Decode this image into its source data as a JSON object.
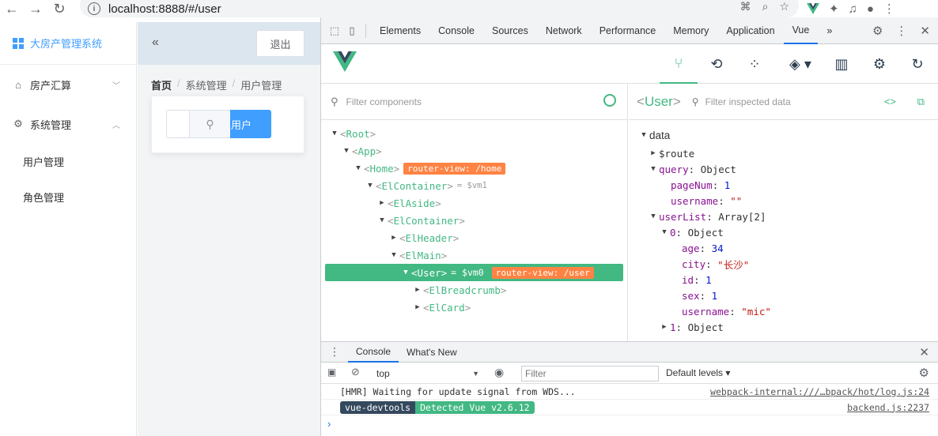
{
  "browser": {
    "url": "localhost:8888/#/user"
  },
  "app": {
    "brand": "大房产管理系统",
    "menu": [
      {
        "label": "房产汇算"
      },
      {
        "label": "系统管理"
      }
    ],
    "submenu": [
      {
        "label": "用户管理"
      },
      {
        "label": "角色管理"
      }
    ],
    "logout_label": "退出",
    "collapse_glyph": "«",
    "breadcrumb": [
      "首页",
      "系统管理",
      "用户管理"
    ],
    "breadcrumb_sep": "/",
    "add_button_label": "加用户"
  },
  "devtools": {
    "tabs": [
      "Elements",
      "Console",
      "Sources",
      "Network",
      "Performance",
      "Memory",
      "Application",
      "Vue"
    ],
    "more": "»",
    "active_tab": "Vue",
    "filter_components_placeholder": "Filter components",
    "filter_inspected_placeholder": "Filter inspected data",
    "selected_component": "User",
    "tree": [
      {
        "name": "Root",
        "open": true
      },
      {
        "name": "App",
        "open": true
      },
      {
        "name": "Home",
        "open": true,
        "badge": "router-view: /home"
      },
      {
        "name": "ElContainer",
        "open": true,
        "vm": "= $vm1"
      },
      {
        "name": "ElAside",
        "open": false
      },
      {
        "name": "ElContainer",
        "open": true
      },
      {
        "name": "ElHeader",
        "open": false
      },
      {
        "name": "ElMain",
        "open": true
      },
      {
        "name": "User",
        "open": true,
        "vm": "= $vm0",
        "badge": "router-view: /user",
        "selected": true
      },
      {
        "name": "ElBreadcrumb",
        "open": false
      },
      {
        "name": "ElCard",
        "open": false
      }
    ],
    "state": {
      "section": "data",
      "route_key": "$route",
      "query_key": "query",
      "query_type": "Object",
      "pageNum_key": "pageNum",
      "pageNum_val": "1",
      "username_key": "username",
      "username_val": "\"\"",
      "userList_key": "userList",
      "userList_type": "Array[2]",
      "item0_key": "0",
      "item0_type": "Object",
      "age_key": "age",
      "age_val": "34",
      "city_key": "city",
      "city_val": "\"长沙\"",
      "id_key": "id",
      "id_val": "1",
      "sex_key": "sex",
      "sex_val": "1",
      "uname_key": "username",
      "uname_val": "\"mic\"",
      "item1_key": "1",
      "item1_type": "Object"
    },
    "drawer": {
      "tabs": [
        "Console",
        "What's New"
      ],
      "context": "top",
      "filter_placeholder": "Filter",
      "levels": "Default levels ▾",
      "messages": [
        {
          "text": "[HMR] Waiting for update signal from WDS...",
          "source": "webpack-internal:///…bpack/hot/log.js:24"
        },
        {
          "tag1": "vue-devtools",
          "tag2": "Detected Vue v2.6.12",
          "source": "backend.js:2237"
        }
      ],
      "prompt": "›"
    }
  },
  "colors": {
    "vue_green": "#42b883",
    "element_blue": "#409eff",
    "badge_orange": "#ff8344"
  }
}
